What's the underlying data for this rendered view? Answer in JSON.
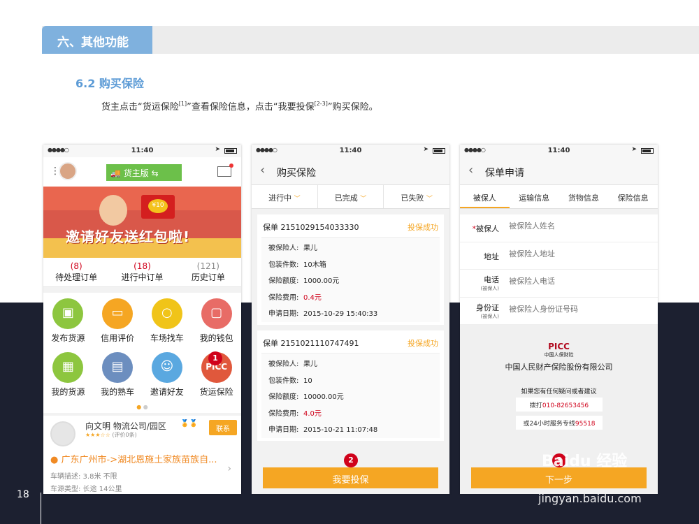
{
  "slide": {
    "section_title": "六、其他功能",
    "subheading": "6.2  购买保险",
    "desc": {
      "part1": "货主点击“货运保险",
      "ref1": "[1]",
      "part2": "”查看保险信息，点击“我要投保",
      "ref2": "[2-3]",
      "part3": "”购买保险。"
    },
    "page_number": "18"
  },
  "status_bar": {
    "dots": "●●●●○",
    "time": "11:40"
  },
  "phone1": {
    "logo": "货主版",
    "banner_text": "邀请好友送红包啦!",
    "banner_coin": "¥10",
    "orders": [
      {
        "count": "(8)",
        "label": "待处理订单"
      },
      {
        "count": "(18)",
        "label": "进行中订单"
      },
      {
        "count": "(121)",
        "label": "历史订单"
      }
    ],
    "grid": [
      {
        "label": "发布货源",
        "color": "#8dc63f",
        "icon": "box-icon"
      },
      {
        "label": "信用评价",
        "color": "#f5a623",
        "icon": "chat-icon"
      },
      {
        "label": "车场找车",
        "color": "#f0c419",
        "icon": "search-icon"
      },
      {
        "label": "我的钱包",
        "color": "#e86c66",
        "icon": "wallet-icon"
      },
      {
        "label": "我的货源",
        "color": "#8dc63f",
        "icon": "boxes-icon"
      },
      {
        "label": "我的熟车",
        "color": "#6c8ebf",
        "icon": "truck-icon"
      },
      {
        "label": "邀请好友",
        "color": "#5aa8e0",
        "icon": "people-icon"
      },
      {
        "label": "货运保险",
        "color": "#e0583c",
        "icon": "picc-icon",
        "text": "PICC"
      }
    ],
    "card": {
      "name": "向文明  物流公司/园区",
      "rating_note": "(评价0条)",
      "contact": "联系",
      "route": "广东广州市->湖北恩施土家族苗族自...",
      "vehicle_desc": "车辆描述: 3.8米  不限",
      "source_type": "车源类型: 长途  14公里"
    }
  },
  "phone2": {
    "title": "购买保险",
    "filters": [
      "进行中",
      "已完成",
      "已失败"
    ],
    "policies": [
      {
        "number": "保单  2151029154033330",
        "status": "投保成功",
        "rows": [
          {
            "key": "被保险人:",
            "value": "果儿"
          },
          {
            "key": "包装件数:",
            "value": "10木箱"
          },
          {
            "key": "保险额度:",
            "value": "1000.00元"
          },
          {
            "key": "保险费用:",
            "value": "0.4元"
          },
          {
            "key": "申请日期:",
            "value": "2015-10-29 15:40:33"
          }
        ]
      },
      {
        "number": "保单  2151021110747491",
        "status": "投保成功",
        "rows": [
          {
            "key": "被保险人:",
            "value": "果儿"
          },
          {
            "key": "包装件数:",
            "value": "10"
          },
          {
            "key": "保险额度:",
            "value": "10000.00元"
          },
          {
            "key": "保险费用:",
            "value": "4.0元"
          },
          {
            "key": "申请日期:",
            "value": "2015-10-21 11:07:48"
          }
        ]
      }
    ],
    "buy_button": "我要投保"
  },
  "phone3": {
    "title": "保单申请",
    "tabs": [
      "被保人",
      "运输信息",
      "货物信息",
      "保险信息"
    ],
    "fields": [
      {
        "label": "被保人",
        "sub": "",
        "required": "*",
        "placeholder": "被保险人姓名"
      },
      {
        "label": "地址",
        "sub": "",
        "required": "",
        "placeholder": "被保险人地址"
      },
      {
        "label": "电话",
        "sub": "(被保人)",
        "required": "",
        "placeholder": "被保险人电话"
      },
      {
        "label": "身份证",
        "sub": "(被保人)",
        "required": "",
        "placeholder": "被保险人身份证号码"
      }
    ],
    "picc_logo": "PICC",
    "picc_cn": "中国人保财险",
    "company": "中国人民财产保险股份有限公司",
    "question": "如果您有任何疑问或者建议",
    "hotline_label": "拨打",
    "hotline": "010-82653456",
    "service_label": "或24小时服务专线",
    "service_phone": "95518",
    "next_button": "下一步"
  },
  "badges": [
    "1",
    "2",
    "3"
  ],
  "watermark": {
    "brand": "Baidu 经验",
    "url": "jingyan.baidu.com"
  }
}
